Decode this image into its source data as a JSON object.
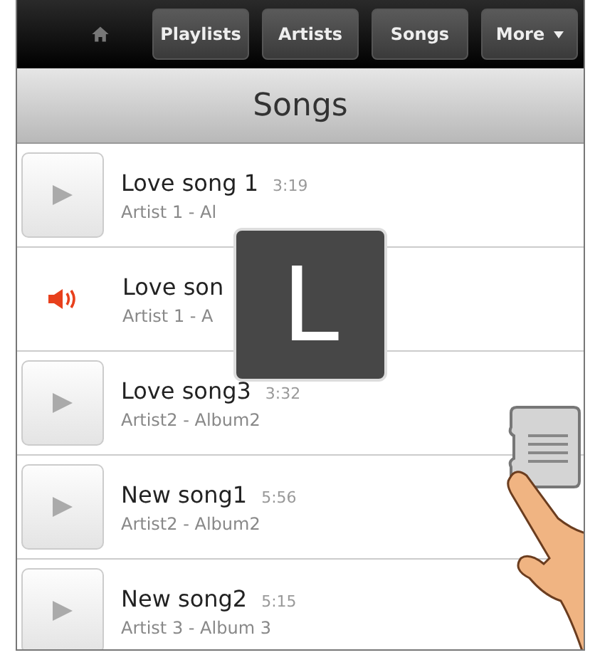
{
  "nav": {
    "buttons": [
      {
        "label": "Playlists",
        "kind": "plain"
      },
      {
        "label": "Artists",
        "kind": "plain"
      },
      {
        "label": "Songs",
        "kind": "plain"
      },
      {
        "label": "More",
        "kind": "menu"
      }
    ]
  },
  "header": {
    "title": "Songs"
  },
  "songs": [
    {
      "title": "Love song 1",
      "duration": "3:19",
      "subtitle": "Artist 1 - Al",
      "playing": false
    },
    {
      "title": "Love son",
      "subtitle": "Artist 1 - A",
      "playing": true
    },
    {
      "title": "Love song3",
      "duration": "3:32",
      "subtitle": "Artist2 - Album2",
      "playing": false
    },
    {
      "title": "New song1",
      "duration": "5:56",
      "subtitle": "Artist2 - Album2",
      "playing": false
    },
    {
      "title": "New song2",
      "duration": "5:15",
      "subtitle": "Artist 3 - Album 3",
      "playing": false
    }
  ],
  "index_overlay": {
    "letter": "L"
  }
}
